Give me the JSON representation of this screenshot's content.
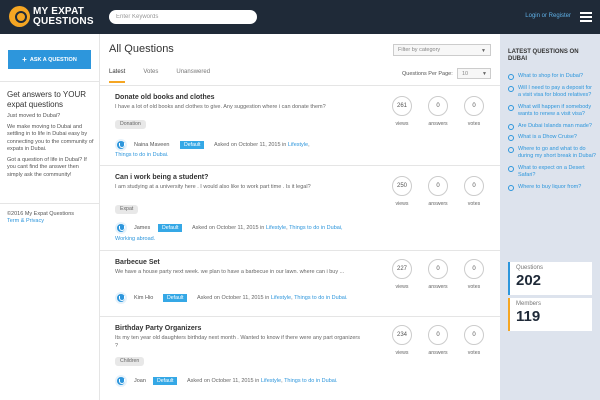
{
  "header": {
    "logo_line1": "MY EXPAT",
    "logo_line2": "QUESTIONS",
    "search_placeholder": "Enter Keywords",
    "login_label": "Login or Register"
  },
  "left": {
    "ask_button": "ASK A QUESTION",
    "promo_title": "Get answers to YOUR expat questions",
    "promo_p1": "Just moved to Dubai?",
    "promo_p2": "We make moving to Dubai and settling in to life in Dubai easy by connecting you to the community of expats in Dubai.",
    "promo_p3": "Got a question of life in Dubai? If you cant find the answer then simply ask the community!",
    "copyright": "©2016 My Expat Questions",
    "terms": "Term & Privacy"
  },
  "main": {
    "title": "All Questions",
    "filter_placeholder": "Filter by category",
    "tabs": [
      "Latest",
      "Votes",
      "Unanswered"
    ],
    "per_page_label": "Questions Per Page:",
    "per_page_value": "10",
    "stat_labels": {
      "views": "views",
      "answers": "answers",
      "votes": "votes"
    },
    "questions": [
      {
        "title": "Donate old books and clothes",
        "excerpt": "I have a lot of old books and clothes to give. Any suggestion where i can donate them?",
        "tag": "Donation",
        "author": "Naina Maveen",
        "badge": "Default",
        "asked": "Asked on October 11, 2015 in",
        "cat1": "Lifestyle",
        "cat2": "Things to do in Dubai.",
        "views": "261",
        "answers": "0",
        "votes": "0"
      },
      {
        "title": "Can i work being a student?",
        "excerpt": "I am studying at a university here . I would also like to work part time . Is it legal?",
        "tag": "Expat",
        "author": "James",
        "badge": "Default",
        "asked": "Asked on October 11, 2015 in",
        "cat1": "Lifestyle",
        "cat2": "Things to do in Dubai,",
        "cat3": "Working abroad.",
        "views": "250",
        "answers": "0",
        "votes": "0"
      },
      {
        "title": "Barbecue Set",
        "excerpt": "We have a house party next week. we plan to have a barbecue in our lawn. where can i buy ...",
        "author": "Kim Hio",
        "badge": "Default",
        "asked": "Asked on October 11, 2015 in",
        "cat1": "Lifestyle",
        "cat2": "Things to do in Dubai.",
        "views": "227",
        "answers": "0",
        "votes": "0"
      },
      {
        "title": "Birthday Party Organizers",
        "excerpt": "Its my ten year old daughters birthday next month . Wanted to know if there were any part organizers ?",
        "tag": "Children",
        "author": "Joan",
        "badge": "Default",
        "asked": "Asked on October 11, 2015 in",
        "cat1": "Lifestyle",
        "cat2": "Things to do in Dubai.",
        "views": "234",
        "answers": "0",
        "votes": "0"
      }
    ]
  },
  "right": {
    "title": "LATEST QUESTIONS ON DUBAI",
    "items": [
      "What to shop for in Dubai?",
      "Will I need to pay a deposit for a visit visa for blood relatives?",
      "What will happen if somebody wants to renew a visit visa?",
      "Are Dubai Islands man made?",
      "What is a Dhow Cruise?",
      "Where to go and what to do during my short break in Dubai?",
      "What to expect on a Desert Safari?",
      "Where to buy liquor from?"
    ],
    "questions_label": "Questions",
    "questions_value": "202",
    "members_label": "Members",
    "members_value": "119"
  },
  "colors": {
    "header_bg": "#1f2a38",
    "accent_blue": "#2d96dc",
    "accent_orange": "#f5a623",
    "sidebar_bg": "#dde3ed"
  }
}
